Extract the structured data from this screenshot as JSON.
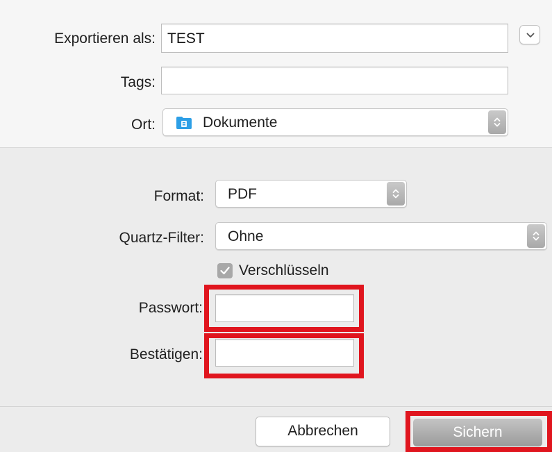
{
  "export_section": {
    "export_as_label": "Exportieren als:",
    "export_as_value": "TEST",
    "tags_label": "Tags:",
    "tags_value": "",
    "location_label": "Ort:",
    "location_value": "Dokumente",
    "location_icon": "folder-icon",
    "expand_icon": "chevron-down-icon"
  },
  "options_section": {
    "format_label": "Format:",
    "format_value": "PDF",
    "quartz_label": "Quartz-Filter:",
    "quartz_value": "Ohne",
    "encrypt_label": "Verschlüsseln",
    "encrypt_checked": true,
    "password_label": "Passwort:",
    "password_value": "",
    "confirm_label": "Bestätigen:",
    "confirm_value": ""
  },
  "buttons": {
    "cancel_label": "Abbrechen",
    "save_label": "Sichern"
  },
  "colors": {
    "highlight": "#e0151e",
    "folder": "#2d9fe6"
  }
}
